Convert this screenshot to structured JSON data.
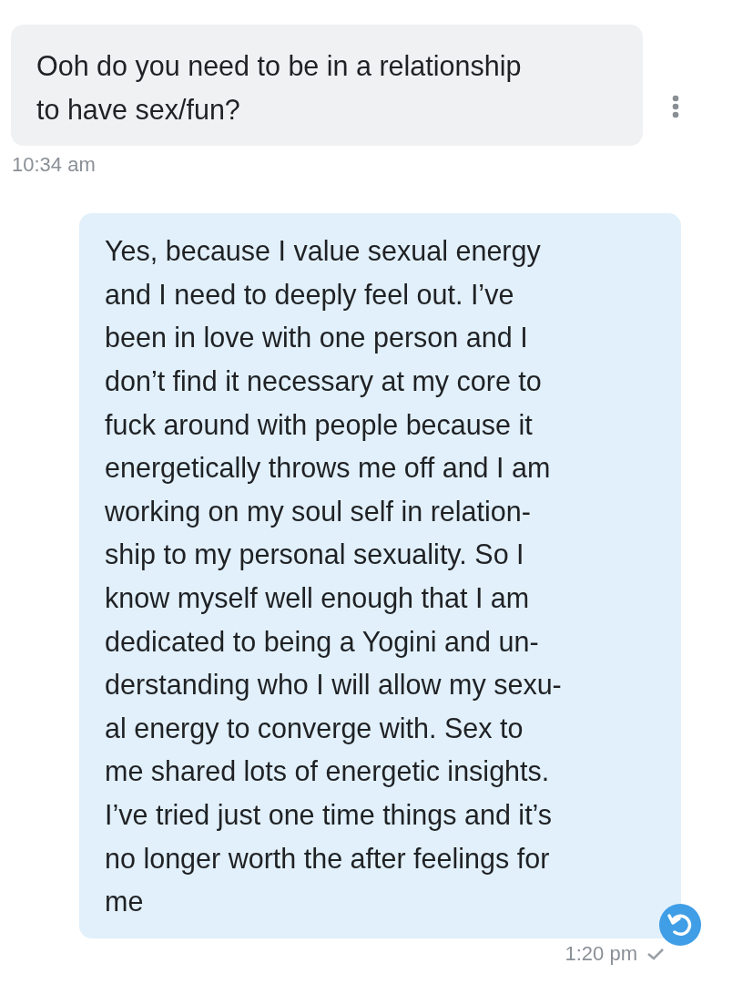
{
  "messages": [
    {
      "kind": "incoming",
      "text": "Ooh do you need to be in a relationship\nto have sex/fun?",
      "time": "10:34 am"
    },
    {
      "kind": "outgoing",
      "text": "Yes, because I value sexual energy\nand I need to deeply feel out. I’ve\nbeen in love with one person and I\ndon’t find it necessary at my core to\nfuck around with people because it\nenergetically throws me off and I am\nworking on my soul self in relation-\nship to my personal sexuality. So I\nknow myself well enough that I am\ndedicated to being a Yogini and un-\nderstanding who I will allow my sexu-\nal energy to converge with. Sex to\nme shared lots of energetic insights.\nI’ve tried just one time things and it’s\nno longer worth the after feelings for\nme",
      "time": "1:20 pm"
    }
  ]
}
